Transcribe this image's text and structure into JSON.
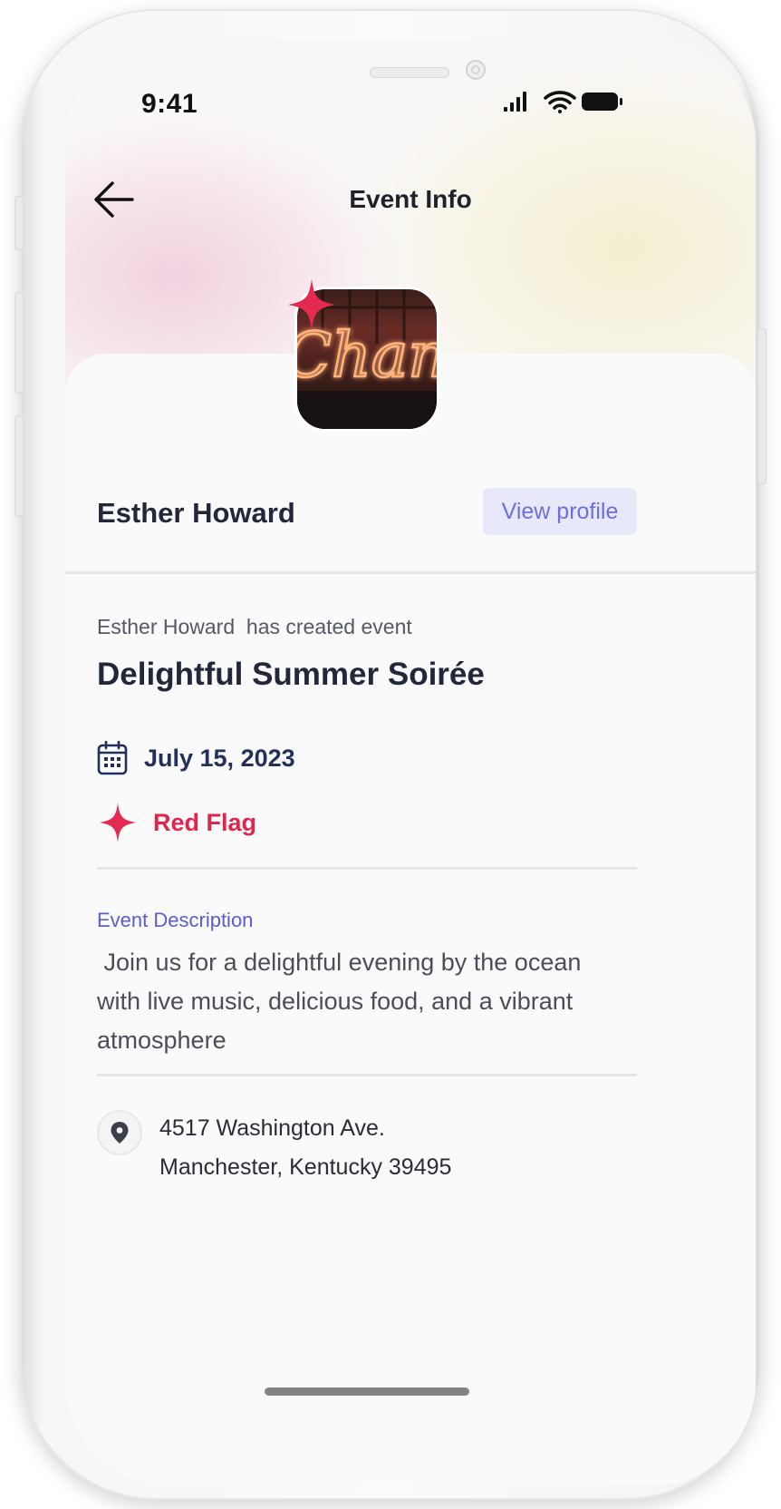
{
  "status_bar": {
    "time": "9:41"
  },
  "header": {
    "title": "Event Info"
  },
  "host": {
    "name": "Esther Howard",
    "view_profile_label": "View profile"
  },
  "event": {
    "creator": "Esther Howard",
    "created_text": "has created event",
    "title": "Delightful Summer Soirée",
    "date": "July 15, 2023",
    "flag_label": "Red Flag",
    "image_sign_text": "Chang"
  },
  "description": {
    "label": "Event Description",
    "text": " Join us for a delightful evening by the ocean with live music, delicious food, and a vibrant atmosphere"
  },
  "location": {
    "line1": "4517 Washington Ave.",
    "line2": "Manchester, Kentucky 39495"
  },
  "colors": {
    "accent": "#5a5cd2",
    "flag_red": "#e0264c",
    "text_dark": "#22273a",
    "button_bg": "#e8e8fb"
  },
  "icons": {
    "back": "arrow-left-icon",
    "calendar": "calendar-icon",
    "flag": "sparkle-star-icon",
    "location": "map-pin-icon",
    "signal": "signal-icon",
    "wifi": "wifi-icon",
    "battery": "battery-icon"
  }
}
